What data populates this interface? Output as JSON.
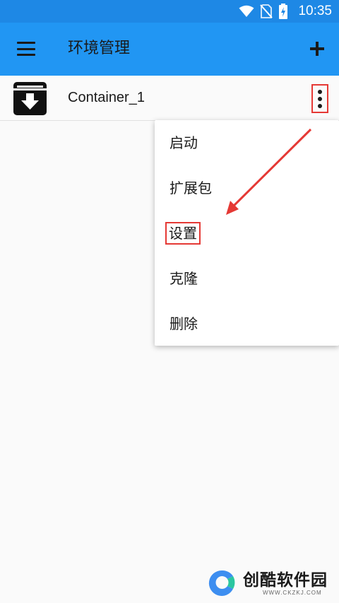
{
  "status_bar": {
    "time": "10:35",
    "icons": [
      "wifi-icon",
      "no-sim-icon",
      "battery-charging-icon"
    ]
  },
  "app_bar": {
    "title": "环境管理",
    "menu_icon": "hamburger-menu-icon",
    "add_icon": "plus-icon"
  },
  "list": {
    "items": [
      {
        "label": "Container_1",
        "icon": "archive-download-icon",
        "more_icon": "more-vert-icon"
      }
    ]
  },
  "popup_menu": {
    "items": [
      {
        "label": "启动"
      },
      {
        "label": "扩展包"
      },
      {
        "label": "设置"
      },
      {
        "label": "克隆"
      },
      {
        "label": "删除"
      }
    ]
  },
  "watermark": {
    "title": "创酷软件园",
    "url": "WWW.CKZKJ.COM"
  },
  "colors": {
    "status_bar": "#1e88e5",
    "app_bar": "#2196f3",
    "highlight": "#e53935",
    "background": "#fafafa"
  }
}
